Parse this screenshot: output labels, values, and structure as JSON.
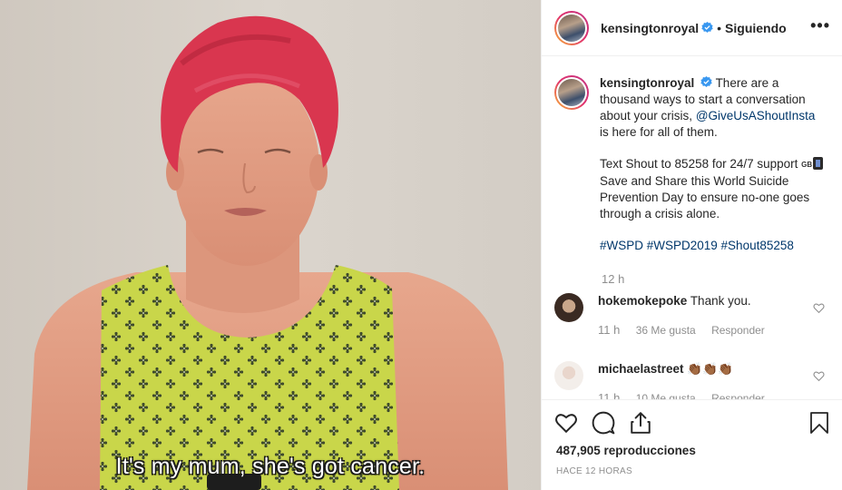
{
  "video": {
    "subtitle": "It's my mum, she's got cancer."
  },
  "header": {
    "username": "kensingtonroyal",
    "separator": "•",
    "follow_status": "Siguiendo",
    "more_label": "•••"
  },
  "caption": {
    "username": "kensingtonroyal",
    "line1": "There are a thousand ways to start a conversation about your crisis,",
    "mention": "@GiveUsAShoutInsta",
    "line1_end": "is here for all of them.",
    "para2_a": "Text Shout to 85258 for 24/7 support",
    "flag_text": "GB",
    "para2_b": "Save and Share this World Suicide Prevention Day to ensure no-one goes through a crisis alone.",
    "hashtags": "#WSPD #WSPD2019 #Shout85258",
    "time": "12 h"
  },
  "comments": [
    {
      "username": "hokemokepoke",
      "text": "Thank you.",
      "time": "11 h",
      "likes": "36 Me gusta",
      "reply_label": "Responder"
    },
    {
      "username": "michaelastreet",
      "text": "👏🏾👏🏾👏🏾",
      "time": "11 h",
      "likes": "10 Me gusta",
      "reply_label": "Responder"
    }
  ],
  "stats": {
    "views": "487,905 reproducciones",
    "posted": "HACE 12 HORAS"
  },
  "icons": {
    "like": "heart-icon",
    "comment": "comment-bubble-icon",
    "share": "share-icon",
    "save": "bookmark-icon",
    "verified": "verified-badge-icon"
  },
  "colors": {
    "verified": "#3897f0",
    "link": "#00376b",
    "muted": "#8e8e8e",
    "hair": "#d9364f",
    "top": "#c8d84a"
  }
}
